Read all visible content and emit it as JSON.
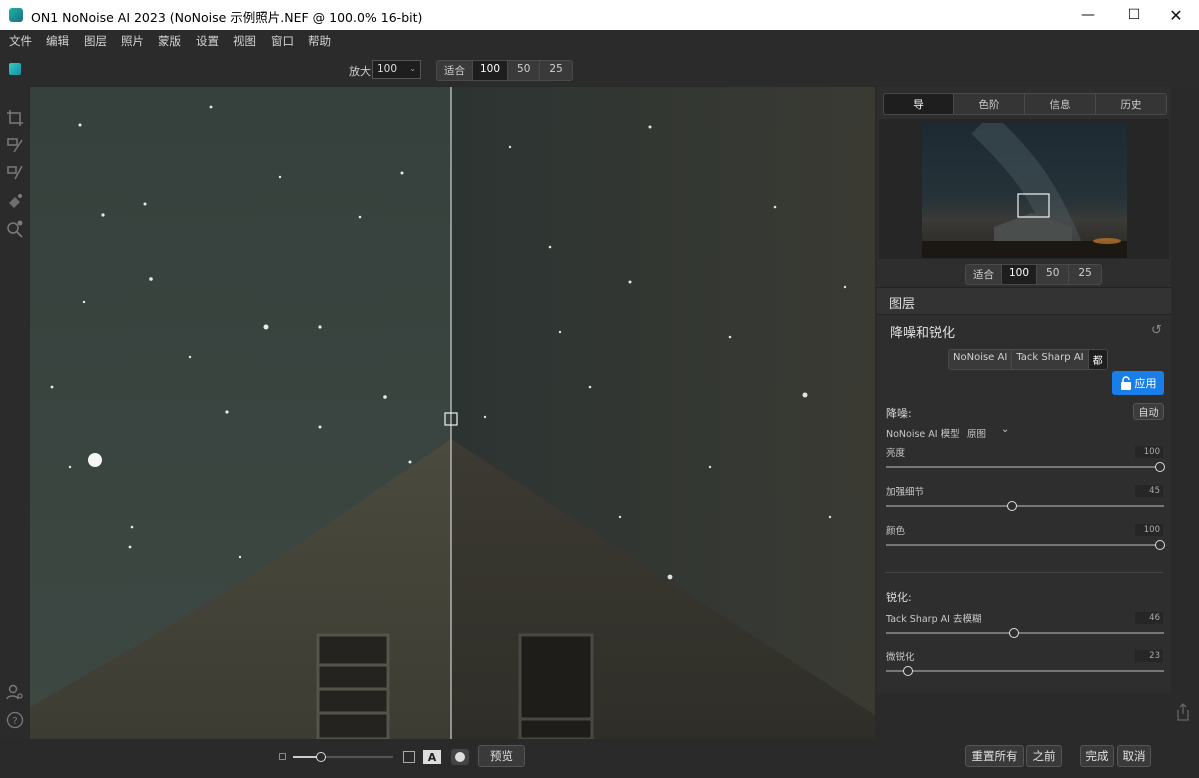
{
  "window": {
    "title": "ON1 NoNoise AI 2023 (NoNoise 示例照片.NEF @ 100.0% 16-bit)",
    "minimize_icon": "minimize-icon",
    "maximize_icon": "maximize-icon",
    "close_icon": "close-icon"
  },
  "menu": [
    "文件",
    "编辑",
    "图层",
    "照片",
    "蒙版",
    "设置",
    "视图",
    "窗口",
    "帮助"
  ],
  "toolbar": {
    "zoom_label": "放大",
    "zoom_value": "100",
    "zoom_presets": [
      "适合",
      "100",
      "50",
      "25"
    ],
    "zoom_selected": "100"
  },
  "left_tools": [
    "crop-icon",
    "brush-icon",
    "refine-brush-icon",
    "eraser-icon",
    "zoom-tool-icon"
  ],
  "navigator": {
    "tabs": [
      "导",
      "色阶",
      "信息",
      "历史"
    ],
    "selected_tab": "导",
    "zoom_presets": [
      "适合",
      "100",
      "50",
      "25"
    ],
    "zoom_selected": "100"
  },
  "layers_title": "图层",
  "panel": {
    "title": "降噪和锐化",
    "reset_icon": "reset-icon",
    "mode_tabs": [
      "NoNoise AI",
      "Tack Sharp AI",
      "都"
    ],
    "mode_selected": "都",
    "apply_label": "应用",
    "noise_title": "降噪:",
    "auto_label": "自动",
    "model_label": "NoNoise AI 模型",
    "model_value": "原图",
    "sliders_noise": [
      {
        "label": "亮度",
        "value": "100",
        "fraction": 1.0
      },
      {
        "label": "加强细节",
        "value": "45",
        "fraction": 0.45
      },
      {
        "label": "颜色",
        "value": "100",
        "fraction": 1.0
      }
    ],
    "sharpen_title": "锐化:",
    "sliders_sharpen": [
      {
        "label": "Tack Sharp AI 去模糊",
        "value": "46",
        "fraction": 0.46
      },
      {
        "label": "微锐化",
        "value": "23",
        "fraction": 0.065
      }
    ]
  },
  "bottom": {
    "preview_label": "预览",
    "reset_all_label": "重置所有",
    "before_label": "之前",
    "done_label": "完成",
    "cancel_label": "取消",
    "text_mode_glyph": "A"
  },
  "colors": {
    "accent": "#1a7ee8",
    "panel_bg": "#2e2e2e",
    "app_bg": "#2a2a2a"
  }
}
